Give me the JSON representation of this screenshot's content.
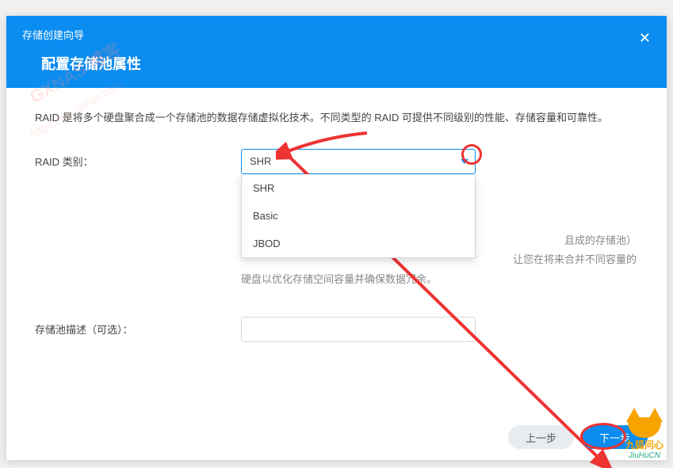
{
  "header": {
    "wizard_title": "存储创建向导",
    "page_title": "配置存储池属性"
  },
  "body": {
    "description": "RAID 是将多个硬盘聚合成一个存储池的数据存储虚拟化技术。不同类型的 RAID 可提供不同级别的性能、存储容量和可靠性。",
    "raid_label": "RAID 类别：",
    "raid_selected": "SHR",
    "raid_options": [
      "SHR",
      "Basic",
      "JBOD"
    ],
    "hint_line1_suffix": "且成的存储池）",
    "hint_line2_suffix": "让您在将来合并不同容量的",
    "hint_line3": "硬盘以优化存储空间容量并确保数据冗余。",
    "desc_label": "存储池描述（可选）：",
    "desc_value": ""
  },
  "footer": {
    "prev": "上一步",
    "next": "下一步"
  },
  "annotations": {
    "watermark_text": "GXNAS 博客",
    "watermark_url": "https://wp.gxnas.com",
    "brand_cn": "九狐问心",
    "brand_py": "JiuHuCN"
  }
}
